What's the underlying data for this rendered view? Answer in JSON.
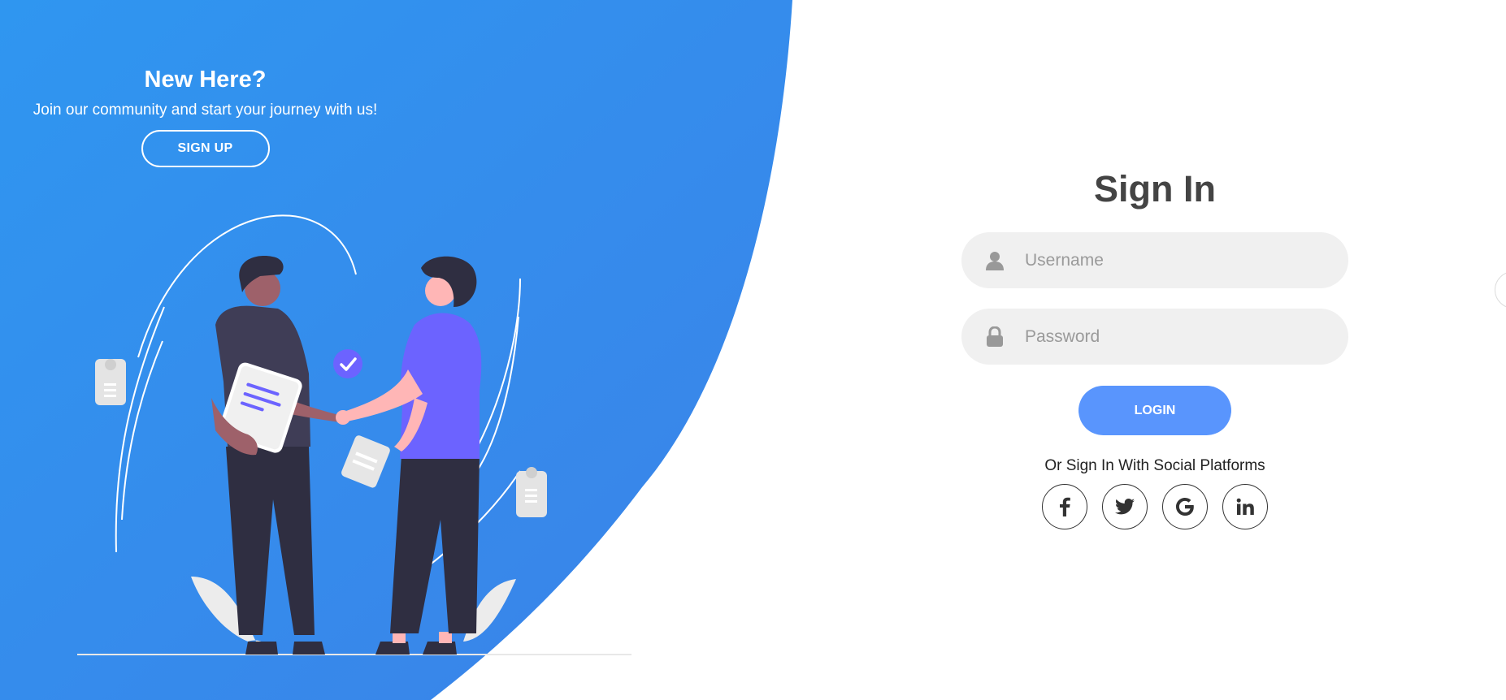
{
  "colors": {
    "blue_start": "#2f96f0",
    "blue_end": "#3b82e8",
    "accent": "#5995fd",
    "shirt_purple": "#6c63ff",
    "field_bg": "#f0f0f0"
  },
  "left_panel": {
    "title": "New Here?",
    "subtitle": "Join our community and start your journey with us!",
    "signup_label": "SIGN UP"
  },
  "sign_in": {
    "title": "Sign In",
    "username": {
      "placeholder": "Username",
      "value": "",
      "icon": "user-icon"
    },
    "password": {
      "placeholder": "Password",
      "value": "",
      "icon": "lock-icon"
    },
    "login_label": "LOGIN",
    "social_text": "Or Sign In With Social Platforms",
    "socials": [
      {
        "name": "facebook",
        "icon": "facebook-icon"
      },
      {
        "name": "twitter",
        "icon": "twitter-icon"
      },
      {
        "name": "google",
        "icon": "google-icon"
      },
      {
        "name": "linkedin",
        "icon": "linkedin-icon"
      }
    ]
  }
}
